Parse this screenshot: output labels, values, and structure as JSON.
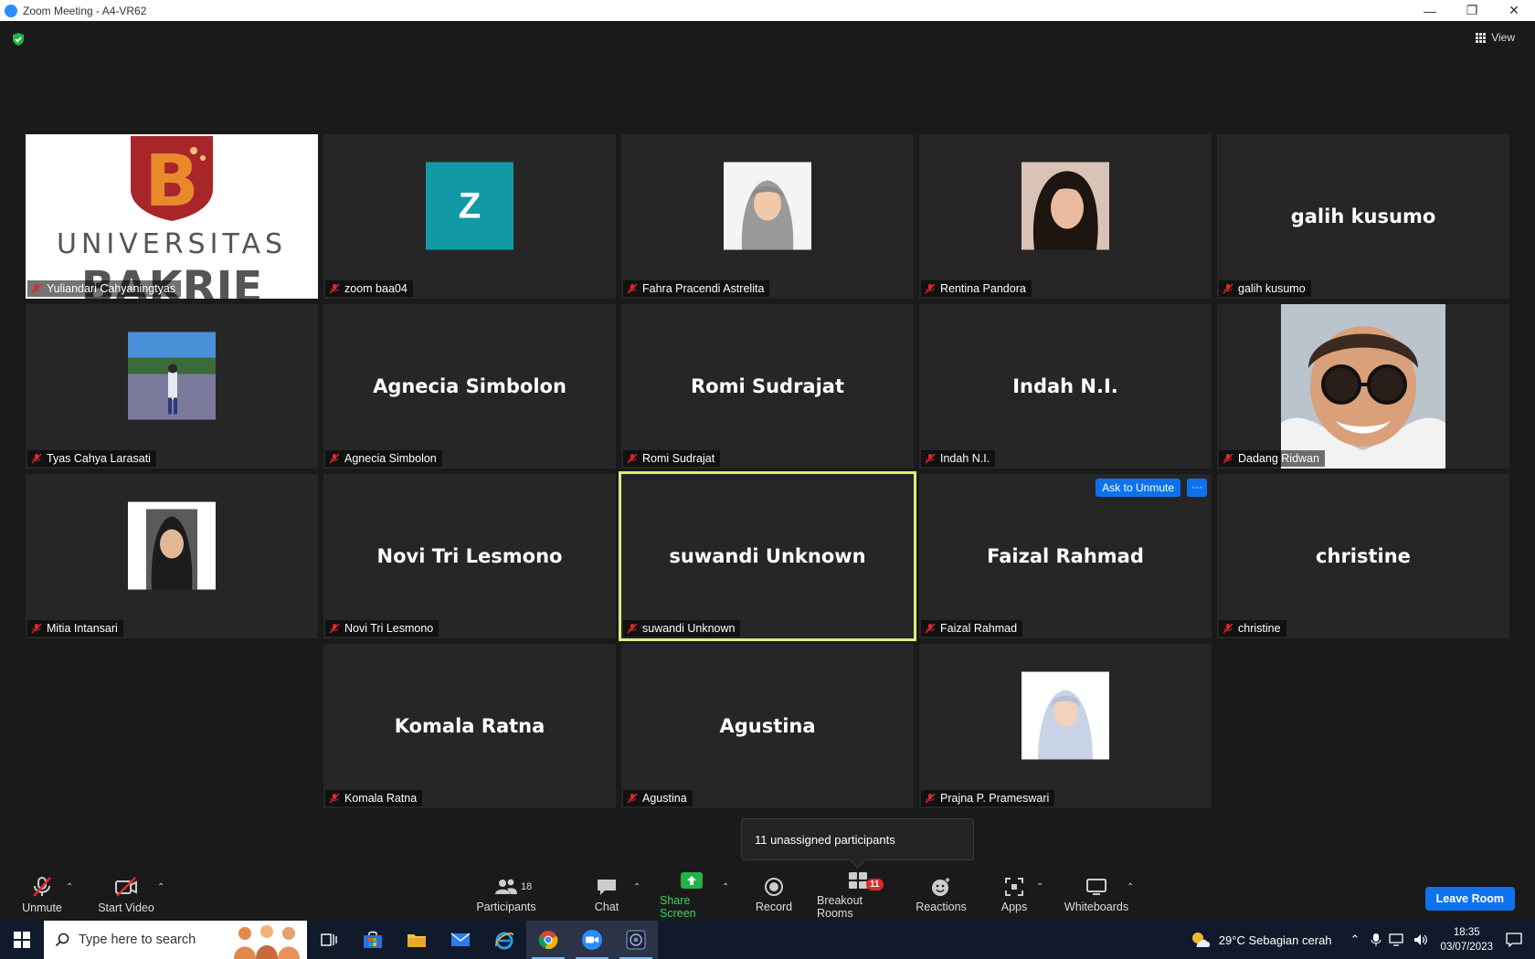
{
  "window": {
    "title": "Zoom Meeting - A4-VR62"
  },
  "topbar": {
    "view_label": "View"
  },
  "tiles": [
    {
      "id": "t1",
      "name": "Yuliandari Cahyaningtyas",
      "logo_line1": "UNIVERSITAS",
      "logo_line2": "BAKRIE",
      "logo_letter": "B"
    },
    {
      "id": "t2",
      "name": "zoom baa04",
      "avatar_letter": "Z"
    },
    {
      "id": "t3",
      "name": "Fahra Pracendi Astrelita"
    },
    {
      "id": "t4",
      "name": "Rentina Pandora"
    },
    {
      "id": "t5",
      "name": "galih kusumo",
      "big": "galih kusumo"
    },
    {
      "id": "t6",
      "name": "Tyas Cahya Larasati"
    },
    {
      "id": "t7",
      "name": "Agnecia Simbolon",
      "big": "Agnecia Simbolon"
    },
    {
      "id": "t8",
      "name": "Romi Sudrajat",
      "big": "Romi Sudrajat"
    },
    {
      "id": "t9",
      "name": "Indah N.I.",
      "big": "Indah N.I."
    },
    {
      "id": "t10",
      "name": "Dadang Ridwan"
    },
    {
      "id": "t11",
      "name": "Mitia Intansari"
    },
    {
      "id": "t12",
      "name": "Novi Tri Lesmono",
      "big": "Novi Tri Lesmono"
    },
    {
      "id": "t13",
      "name": "suwandi Unknown",
      "big": "suwandi Unknown"
    },
    {
      "id": "t14",
      "name": "Faizal Rahmad",
      "big": "Faizal Rahmad",
      "ask_unmute": "Ask to Unmute",
      "more": "···"
    },
    {
      "id": "t15",
      "name": "christine",
      "big": "christine"
    },
    {
      "id": "t16",
      "name": "Komala Ratna",
      "big": "Komala Ratna"
    },
    {
      "id": "t17",
      "name": "Agustina",
      "big": "Agustina"
    },
    {
      "id": "t18",
      "name": "Prajna P. Prameswari"
    }
  ],
  "tooltip": {
    "text": "11 unassigned participants"
  },
  "toolbar": {
    "unmute": "Unmute",
    "start_video": "Start Video",
    "participants": "Participants",
    "participants_count": "18",
    "chat": "Chat",
    "share_screen": "Share Screen",
    "record": "Record",
    "breakout_rooms": "Breakout Rooms",
    "breakout_badge": "11",
    "reactions": "Reactions",
    "apps": "Apps",
    "whiteboards": "Whiteboards",
    "leave_room": "Leave Room"
  },
  "taskbar": {
    "search_placeholder": "Type here to search",
    "weather": "29°C  Sebagian cerah",
    "time": "18:35",
    "date": "03/07/2023"
  },
  "colors": {
    "accent": "#0e72ed",
    "active_speaker": "#d6f07a",
    "share_green": "#3ad45c",
    "mute_red": "#e02828"
  }
}
